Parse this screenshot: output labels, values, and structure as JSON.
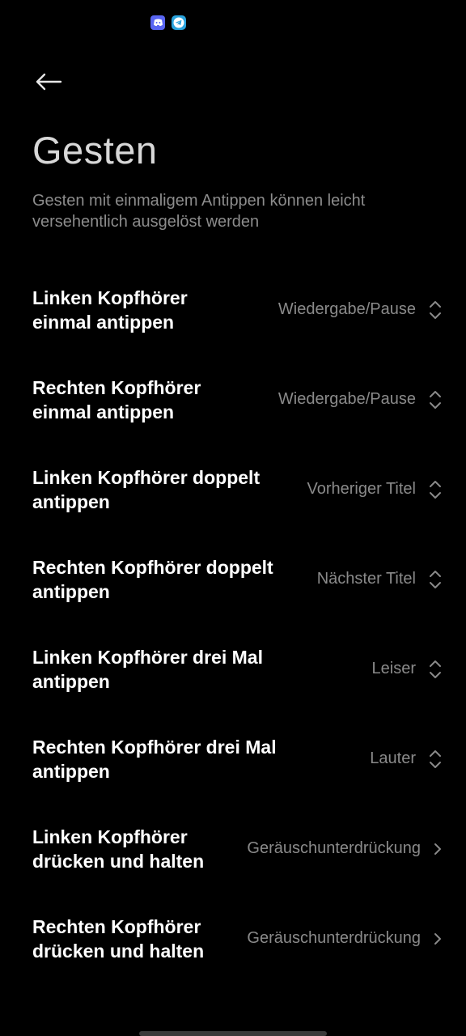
{
  "status_bar": {
    "icons": [
      "discord-icon",
      "telegram-icon"
    ]
  },
  "header": {
    "back_icon": "arrow-left-icon",
    "title": "Gesten",
    "subtitle": "Gesten mit einmaligem Antippen können leicht versehentlich ausgelöst werden"
  },
  "settings": [
    {
      "label_line1": "Linken Kopfhörer",
      "label_line2": "einmal antippen",
      "value": "Wiedergabe/Pause",
      "control": "up-down-chevron-icon"
    },
    {
      "label_line1": "Rechten Kopfhörer",
      "label_line2": "einmal antippen",
      "value": "Wiedergabe/Pause",
      "control": "up-down-chevron-icon"
    },
    {
      "label_line1": "Linken Kopfhörer doppelt",
      "label_line2": "antippen",
      "value": "Vorheriger Titel",
      "control": "up-down-chevron-icon"
    },
    {
      "label_line1": "Rechten Kopfhörer doppelt",
      "label_line2": "antippen",
      "value": "Nächster Titel",
      "control": "up-down-chevron-icon"
    },
    {
      "label_line1": "Linken Kopfhörer drei Mal",
      "label_line2": "antippen",
      "value": "Leiser",
      "control": "up-down-chevron-icon"
    },
    {
      "label_line1": "Rechten Kopfhörer drei Mal",
      "label_line2": "antippen",
      "value": "Lauter",
      "control": "up-down-chevron-icon"
    },
    {
      "label_line1": "Linken Kopfhörer",
      "label_line2": "drücken und halten",
      "value": "Geräuschunterdrückung",
      "control": "chevron-right-icon"
    },
    {
      "label_line1": "Rechten Kopfhörer",
      "label_line2": "drücken und halten",
      "value": "Geräuschunterdrückung",
      "control": "chevron-right-icon"
    }
  ],
  "colors": {
    "background": "#000000",
    "title": "#d8d8d8",
    "subtitle": "#8c8c8c",
    "label": "#ffffff",
    "value": "#8a8a8a",
    "discord": "#5865f2",
    "telegram": "#2aa3dd"
  }
}
